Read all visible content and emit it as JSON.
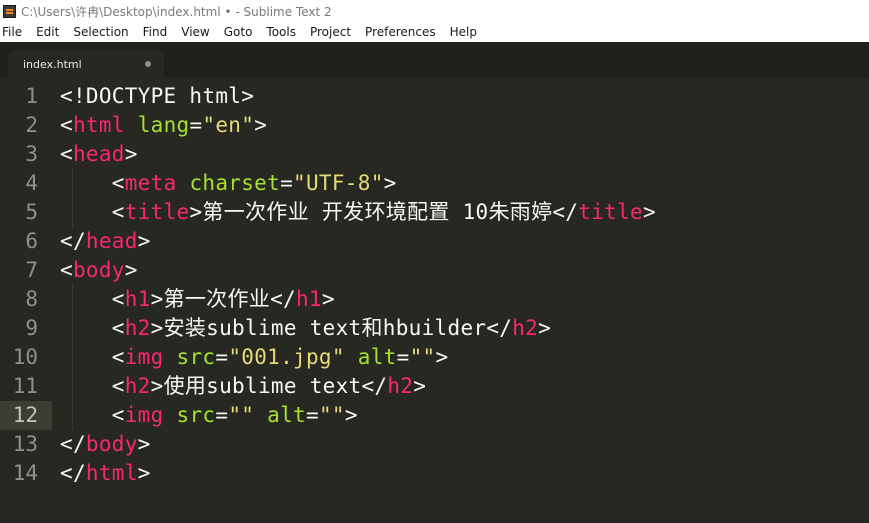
{
  "window": {
    "title": "C:\\Users\\许冉\\Desktop\\index.html • - Sublime Text 2"
  },
  "menu": [
    "File",
    "Edit",
    "Selection",
    "Find",
    "View",
    "Goto",
    "Tools",
    "Project",
    "Preferences",
    "Help"
  ],
  "tab": {
    "label": "index.html",
    "dirty": true
  },
  "colors": {
    "background": "#272822",
    "tag": "#f92672",
    "attribute": "#a6e22e",
    "string": "#e6db74",
    "text": "#f8f8f2",
    "line_number": "#8f908a",
    "current_line": "#3e3d32"
  },
  "editor": {
    "current_line": 12,
    "lines": [
      {
        "n": "1",
        "indent": 0,
        "tokens": [
          [
            "p",
            "<!DOCTYPE html>"
          ]
        ]
      },
      {
        "n": "2",
        "indent": 0,
        "tokens": [
          [
            "p",
            "<"
          ],
          [
            "t",
            "html"
          ],
          [
            "p",
            " "
          ],
          [
            "a",
            "lang"
          ],
          [
            "p",
            "="
          ],
          [
            "s",
            "\"en\""
          ],
          [
            "p",
            ">"
          ]
        ]
      },
      {
        "n": "3",
        "indent": 0,
        "tokens": [
          [
            "p",
            "<"
          ],
          [
            "t",
            "head"
          ],
          [
            "p",
            ">"
          ]
        ]
      },
      {
        "n": "4",
        "indent": 1,
        "tokens": [
          [
            "p",
            "<"
          ],
          [
            "t",
            "meta"
          ],
          [
            "p",
            " "
          ],
          [
            "a",
            "charset"
          ],
          [
            "p",
            "="
          ],
          [
            "s",
            "\"UTF-8\""
          ],
          [
            "p",
            ">"
          ]
        ]
      },
      {
        "n": "5",
        "indent": 1,
        "tokens": [
          [
            "p",
            "<"
          ],
          [
            "t",
            "title"
          ],
          [
            "p",
            ">第一次作业 开发环境配置 10朱雨婷</"
          ],
          [
            "t",
            "title"
          ],
          [
            "p",
            ">"
          ]
        ]
      },
      {
        "n": "6",
        "indent": 0,
        "tokens": [
          [
            "p",
            "</"
          ],
          [
            "t",
            "head"
          ],
          [
            "p",
            ">"
          ]
        ]
      },
      {
        "n": "7",
        "indent": 0,
        "tokens": [
          [
            "p",
            "<"
          ],
          [
            "t",
            "body"
          ],
          [
            "p",
            ">"
          ]
        ]
      },
      {
        "n": "8",
        "indent": 1,
        "tokens": [
          [
            "p",
            "<"
          ],
          [
            "t",
            "h1"
          ],
          [
            "p",
            ">第一次作业</"
          ],
          [
            "t",
            "h1"
          ],
          [
            "p",
            ">"
          ]
        ]
      },
      {
        "n": "9",
        "indent": 1,
        "tokens": [
          [
            "p",
            "<"
          ],
          [
            "t",
            "h2"
          ],
          [
            "p",
            ">安装sublime text和hbuilder</"
          ],
          [
            "t",
            "h2"
          ],
          [
            "p",
            ">"
          ]
        ]
      },
      {
        "n": "10",
        "indent": 1,
        "tokens": [
          [
            "p",
            "<"
          ],
          [
            "t",
            "img"
          ],
          [
            "p",
            " "
          ],
          [
            "a",
            "src"
          ],
          [
            "p",
            "="
          ],
          [
            "s",
            "\"001.jpg\""
          ],
          [
            "p",
            " "
          ],
          [
            "a",
            "alt"
          ],
          [
            "p",
            "="
          ],
          [
            "s",
            "\"\""
          ],
          [
            "p",
            ">"
          ]
        ]
      },
      {
        "n": "11",
        "indent": 1,
        "tokens": [
          [
            "p",
            "<"
          ],
          [
            "t",
            "h2"
          ],
          [
            "p",
            ">使用sublime text</"
          ],
          [
            "t",
            "h2"
          ],
          [
            "p",
            ">"
          ]
        ]
      },
      {
        "n": "12",
        "indent": 1,
        "tokens": [
          [
            "p",
            "<"
          ],
          [
            "t",
            "img"
          ],
          [
            "p",
            " "
          ],
          [
            "a",
            "src"
          ],
          [
            "p",
            "="
          ],
          [
            "s",
            "\"\""
          ],
          [
            "p",
            " "
          ],
          [
            "a",
            "alt"
          ],
          [
            "p",
            "="
          ],
          [
            "s",
            "\"\""
          ],
          [
            "p",
            ">"
          ]
        ]
      },
      {
        "n": "13",
        "indent": 0,
        "tokens": [
          [
            "p",
            "</"
          ],
          [
            "t",
            "body"
          ],
          [
            "p",
            ">"
          ]
        ]
      },
      {
        "n": "14",
        "indent": 0,
        "tokens": [
          [
            "p",
            "</"
          ],
          [
            "t",
            "html"
          ],
          [
            "p",
            ">"
          ]
        ]
      }
    ]
  }
}
